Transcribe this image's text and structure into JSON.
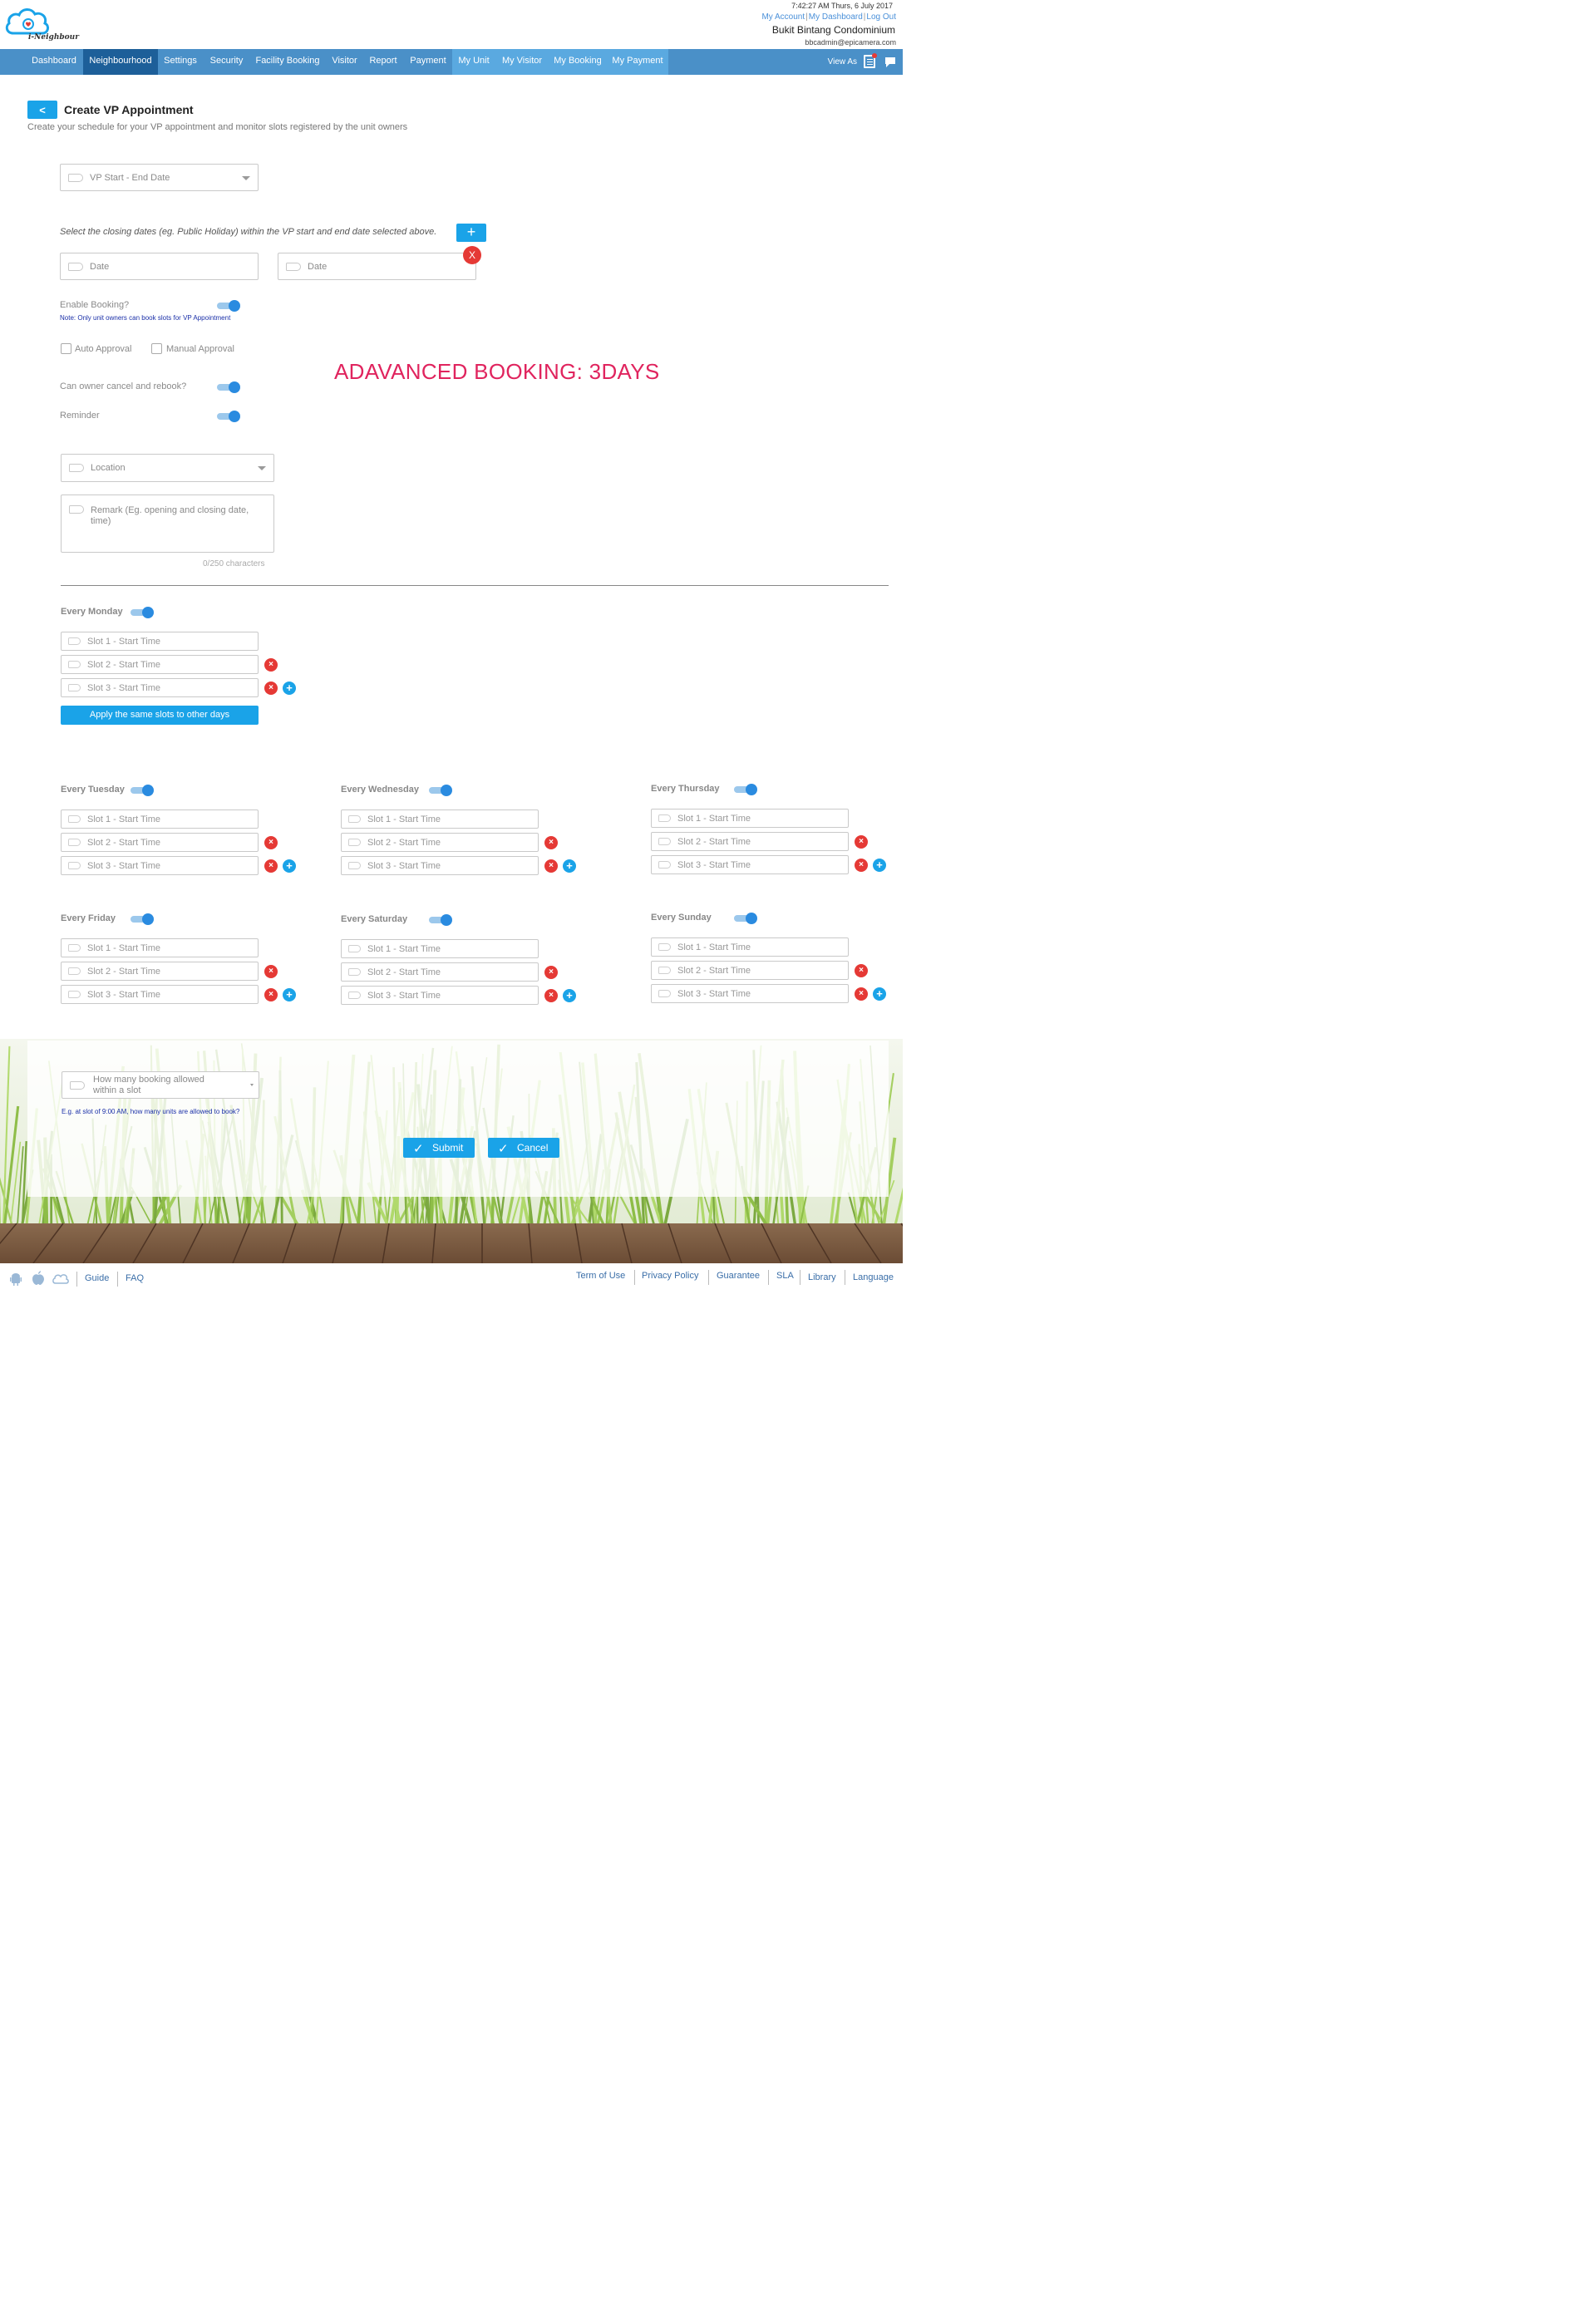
{
  "header": {
    "logo_text": "i-Neighbour",
    "datetime": "7:42:27 AM  Thurs, 6 July 2017",
    "links": [
      "My Account",
      "My Dashboard",
      "Log Out"
    ],
    "condo_name": "Bukit Bintang Condominium",
    "email": "bbcadmin@epicamera.com"
  },
  "nav": {
    "items": [
      "Dashboard",
      "Neighbourhood",
      "Settings",
      "Security",
      "Facility Booking",
      "Visitor",
      "Report",
      "Payment",
      "My Unit",
      "My Visitor",
      "My Booking",
      "My Payment"
    ],
    "active": "Neighbourhood",
    "view_as": "View As"
  },
  "page": {
    "back_label": "<",
    "title": "Create VP Appointment",
    "subtitle": "Create your schedule for your VP appointment and monitor slots registered by the unit owners"
  },
  "form": {
    "vp_date_placeholder": "VP Start - End Date",
    "closing_dates_text": "Select the closing dates (eg. Public Holiday) within the VP start and end date selected above.",
    "add_date_label": "+",
    "date_placeholder_1": "Date",
    "date_placeholder_2": "Date",
    "remove_date_label": "X",
    "enable_booking_label": "Enable Booking?",
    "enable_booking_note": "Note: Only unit owners can book slots for VP Appointment",
    "auto_approval_label": "Auto Approval",
    "manual_approval_label": "Manual Approval",
    "cancel_rebook_label": "Can owner cancel and rebook?",
    "reminder_label": "Reminder",
    "location_placeholder": "Location",
    "remark_placeholder_line1": "Remark (Eg. opening and closing date,",
    "remark_placeholder_line2": "time)",
    "char_count": "0/250 characters",
    "advanced_booking_note": "ADAVANCED BOOKING: 3DAYS"
  },
  "slots": {
    "slot1": "Slot 1 - Start Time",
    "slot2": "Slot 2 - Start Time",
    "slot3": "Slot 3 - Start Time",
    "remove_symbol": "×",
    "add_symbol": "+",
    "apply_label": "Apply the same slots to other days"
  },
  "days": [
    "Every Monday",
    "Every Tuesday",
    "Every Wednesday",
    "Every Thursday",
    "Every Friday",
    "Every Saturday",
    "Every Sunday"
  ],
  "booking_limit": {
    "placeholder_line1": "How many booking allowed",
    "placeholder_line2": "within a slot",
    "note": "E.g. at slot of 9:00 AM, how many units are allowed to book?"
  },
  "actions": {
    "submit": "Submit",
    "cancel": "Cancel"
  },
  "footer": {
    "left_links": [
      "Guide",
      "FAQ"
    ],
    "right_links": [
      "Term of Use",
      "Privacy Policy",
      "Guarantee",
      "SLA",
      "Library",
      "Language"
    ]
  },
  "colors": {
    "accent": "#1aa3e8",
    "nav_bg": "#4a90c8",
    "nav_active": "#1d5f99",
    "remove": "#e53935",
    "note_red": "#e0245e"
  }
}
